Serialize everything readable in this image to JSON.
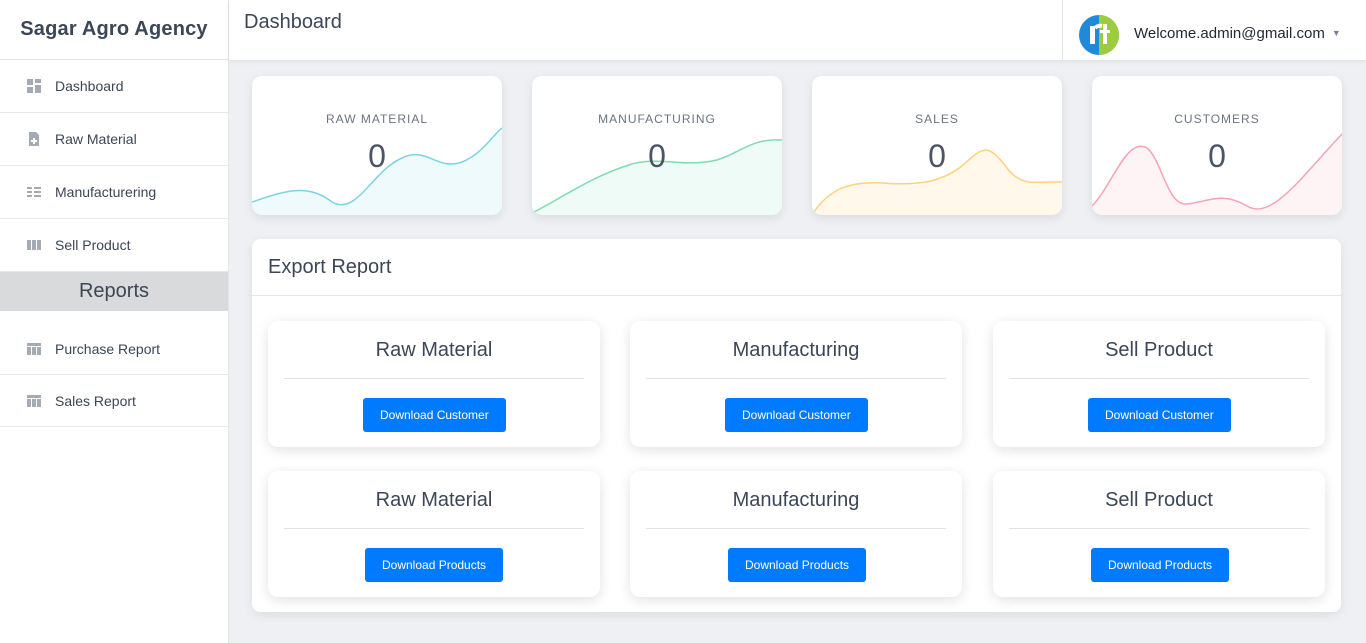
{
  "brand": "Sagar Agro Agency",
  "topbar": {
    "title": "Dashboard",
    "welcome": "Welcome.admin@gmail.com"
  },
  "sidebar": {
    "items": [
      {
        "label": "Dashboard",
        "icon": "dashboard-icon"
      },
      {
        "label": "Raw Material",
        "icon": "file-plus-icon"
      },
      {
        "label": "Manufacturering",
        "icon": "list-icon"
      },
      {
        "label": "Sell Product",
        "icon": "columns-icon"
      }
    ],
    "section_header": "Reports",
    "report_items": [
      {
        "label": "Purchase Report",
        "icon": "table-icon"
      },
      {
        "label": "Sales Report",
        "icon": "table-icon"
      }
    ]
  },
  "stats": [
    {
      "label": "RAW MATERIAL",
      "value": "0",
      "color": "#7dd3e3"
    },
    {
      "label": "MANUFACTURING",
      "value": "0",
      "color": "#7fdcb1"
    },
    {
      "label": "SALES",
      "value": "0",
      "color": "#ffd17a"
    },
    {
      "label": "CUSTOMERS",
      "value": "0",
      "color": "#f4a3b5"
    }
  ],
  "export": {
    "title": "Export Report",
    "cards": [
      {
        "title": "Raw Material",
        "button": "Download Customer"
      },
      {
        "title": "Manufacturing",
        "button": "Download Customer"
      },
      {
        "title": "Sell Product",
        "button": "Download Customer"
      },
      {
        "title": "Raw Material",
        "button": "Download Products"
      },
      {
        "title": "Manufacturing",
        "button": "Download Products"
      },
      {
        "title": "Sell Product",
        "button": "Download Products"
      }
    ]
  },
  "colors": {
    "primary": "#007bff",
    "accent_green": "#9ccc3c",
    "accent_blue": "#1f8ad9"
  }
}
